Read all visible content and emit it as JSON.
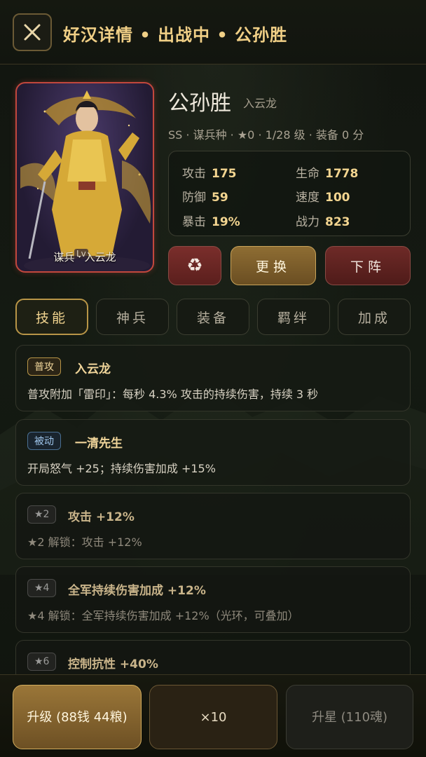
{
  "header": {
    "title": "好汉详情 • 出战中 • 公孙胜"
  },
  "hero": {
    "name": "公孙胜",
    "alias": "入云龙",
    "meta": "SS · 谋兵种 · ★0 · 1/28 级 · 装备 0 分",
    "portrait_caption": "谋兵 · 入云龙",
    "portrait_level_tag": "Lv",
    "stats": [
      {
        "label": "攻击",
        "value": "175"
      },
      {
        "label": "生命",
        "value": "1778"
      },
      {
        "label": "防御",
        "value": "59"
      },
      {
        "label": "速度",
        "value": "100"
      },
      {
        "label": "暴击",
        "value": "19%"
      },
      {
        "label": "战力",
        "value": "823"
      }
    ]
  },
  "actions": {
    "recycle_icon": "♻",
    "swap": "更换",
    "remove": "下阵"
  },
  "tabs": [
    {
      "label": "技能",
      "active": true
    },
    {
      "label": "神兵",
      "active": false
    },
    {
      "label": "装备",
      "active": false
    },
    {
      "label": "羁绊",
      "active": false
    },
    {
      "label": "加成",
      "active": false
    }
  ],
  "skills": [
    {
      "badge": "普攻",
      "title": "入云龙",
      "desc": "普攻附加「雷印」：每秒 4.3% 攻击的持续伤害，持续 3 秒"
    },
    {
      "badge": "被动",
      "title": "一清先生",
      "desc": "开局怒气 +25；持续伤害加成 +15%"
    },
    {
      "badge": "★2",
      "title": "攻击 +12%",
      "desc": "★2 解锁：攻击 +12%"
    },
    {
      "badge": "★4",
      "title": "全军持续伤害加成 +12%",
      "desc": "★4 解锁：全军持续伤害加成 +12%（光环，可叠加）"
    },
    {
      "badge": "★6",
      "title": "控制抗性 +40%",
      "desc": ""
    }
  ],
  "bottom": {
    "upgrade": "升级 (88钱 44粮)",
    "x10": "×10",
    "star_up": "升星 (110魂)"
  },
  "colors": {
    "accent_gold": "#f0cf86",
    "portrait_border": "#c2473d",
    "passive_blue": "#9fc6ec"
  }
}
